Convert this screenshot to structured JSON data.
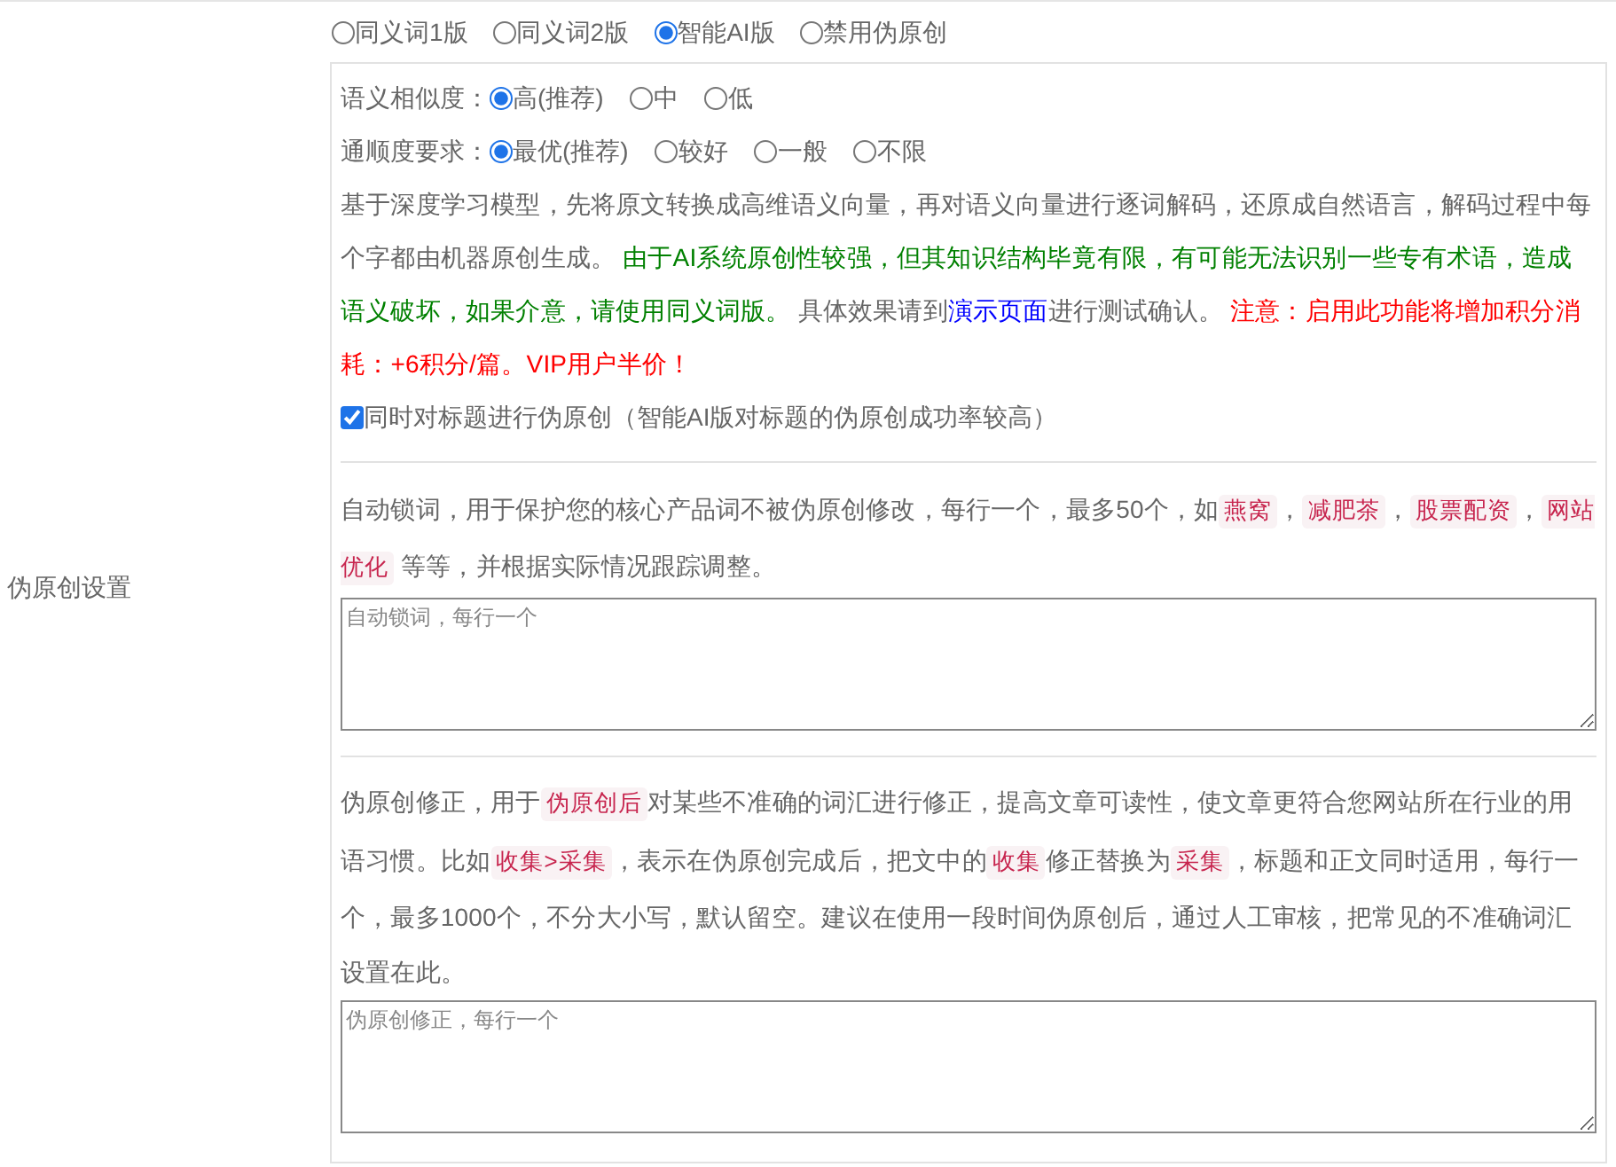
{
  "section_label": "伪原创设置",
  "mode_options": [
    {
      "label": "同义词1版",
      "selected": false
    },
    {
      "label": "同义词2版",
      "selected": false
    },
    {
      "label": "智能AI版",
      "selected": true
    },
    {
      "label": "禁用伪原创",
      "selected": false
    }
  ],
  "similarity": {
    "label": "语义相似度：",
    "options": [
      {
        "label": "高(推荐)",
        "selected": true
      },
      {
        "label": "中",
        "selected": false
      },
      {
        "label": "低",
        "selected": false
      }
    ]
  },
  "fluency": {
    "label": "通顺度要求：",
    "options": [
      {
        "label": "最优(推荐)",
        "selected": true
      },
      {
        "label": "较好",
        "selected": false
      },
      {
        "label": "一般",
        "selected": false
      },
      {
        "label": "不限",
        "selected": false
      }
    ]
  },
  "description": [
    {
      "kind": "text",
      "text": "基于深度学习模型，先将原文转换成高维语义向量，再对语义向量进行逐词解码，还原成自然语言，解码过程中每个字都由机器原创生成。 "
    },
    {
      "kind": "green",
      "text": "由于AI系统原创性较强，但其知识结构毕竟有限，有可能无法识别一些专有术语，造成语义破坏，如果介意，请使用同义词版。"
    },
    {
      "kind": "text",
      "text": " 具体效果请到"
    },
    {
      "kind": "link",
      "text": "演示页面"
    },
    {
      "kind": "text",
      "text": "进行测试确认。 "
    },
    {
      "kind": "red",
      "text": "注意：启用此功能将增加积分消耗：+6积分/篇。VIP用户半价！"
    }
  ],
  "title_option": {
    "label": "同时对标题进行伪原创（智能AI版对标题的伪原创成功率较高）",
    "checked": true
  },
  "lock_words": {
    "description": [
      {
        "kind": "text",
        "text": "自动锁词，用于保护您的核心产品词不被伪原创修改，每行一个，最多50个，如"
      },
      {
        "kind": "code",
        "text": "燕窝"
      },
      {
        "kind": "text",
        "text": "，"
      },
      {
        "kind": "code",
        "text": "减肥茶"
      },
      {
        "kind": "text",
        "text": "，"
      },
      {
        "kind": "code",
        "text": "股票配资"
      },
      {
        "kind": "text",
        "text": "，"
      },
      {
        "kind": "code",
        "text": "网站优化"
      },
      {
        "kind": "text",
        "text": " 等等，并根据实际情况跟踪调整。"
      }
    ],
    "placeholder": "自动锁词，每行一个"
  },
  "correction": {
    "description": [
      {
        "kind": "text",
        "text": "伪原创修正，用于"
      },
      {
        "kind": "code",
        "text": "伪原创后"
      },
      {
        "kind": "text",
        "text": "对某些不准确的词汇进行修正，提高文章可读性，使文章更符合您网站所在行业的用语习惯。比如"
      },
      {
        "kind": "code",
        "text": "收集>采集"
      },
      {
        "kind": "text",
        "text": "，表示在伪原创完成后，把文中的"
      },
      {
        "kind": "code",
        "text": "收集"
      },
      {
        "kind": "text",
        "text": "修正替换为"
      },
      {
        "kind": "code",
        "text": "采集"
      },
      {
        "kind": "text",
        "text": "，标题和正文同时适用，每行一个，最多1000个，不分大小写，默认留空。建议在使用一段时间伪原创后，通过人工审核，把常见的不准确词汇设置在此。"
      }
    ],
    "placeholder": "伪原创修正，每行一个"
  }
}
